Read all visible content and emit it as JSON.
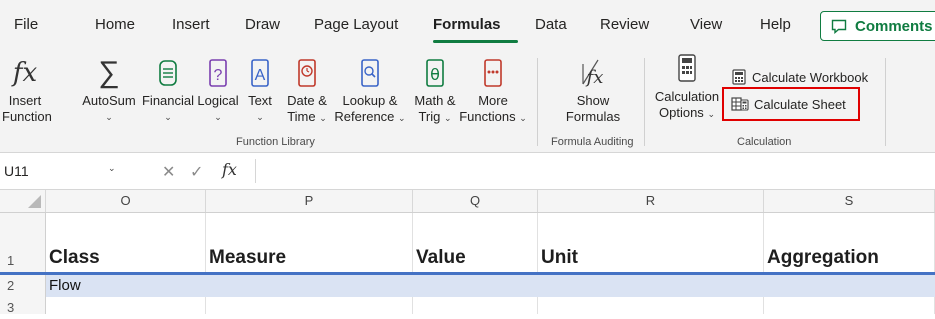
{
  "menu": {
    "tabs": [
      "File",
      "Home",
      "Insert",
      "Draw",
      "Page Layout",
      "Formulas",
      "Data",
      "Review",
      "View",
      "Help"
    ],
    "active_tab": "Formulas",
    "comments_label": "Comments",
    "accent_color": "#107c41"
  },
  "ribbon": {
    "function_library": {
      "insert_function": [
        "Insert",
        "Function"
      ],
      "autosum": "AutoSum",
      "financial": "Financial",
      "logical": "Logical",
      "text": "Text",
      "datetime": [
        "Date &",
        "Time"
      ],
      "lookup": [
        "Lookup &",
        "Reference"
      ],
      "mathtrig": [
        "Math &",
        "Trig"
      ],
      "more": [
        "More",
        "Functions"
      ],
      "group_label": "Function Library"
    },
    "formula_auditing": {
      "show_formulas": [
        "Show",
        "Formulas"
      ],
      "group_label": "Formula Auditing"
    },
    "calculation": {
      "options": [
        "Calculation",
        "Options"
      ],
      "calc_workbook": "Calculate Workbook",
      "calc_sheet": "Calculate Sheet",
      "group_label": "Calculation",
      "highlight_color": "#e00000"
    }
  },
  "formula_bar": {
    "name_box": "U11",
    "fx": "fx",
    "formula": ""
  },
  "grid": {
    "columns": [
      "O",
      "P",
      "Q",
      "R",
      "S"
    ],
    "rows": [
      {
        "num": "1",
        "cells": [
          "Class",
          "Measure",
          "Value",
          "Unit",
          "Aggregation"
        ]
      },
      {
        "num": "2",
        "cells": [
          "Flow",
          "",
          "",
          "",
          ""
        ]
      },
      {
        "num": "3",
        "cells": [
          "",
          "",
          "",
          "",
          ""
        ]
      }
    ],
    "header_underline_color": "#4472c4",
    "band_color": "#dae3f3"
  }
}
